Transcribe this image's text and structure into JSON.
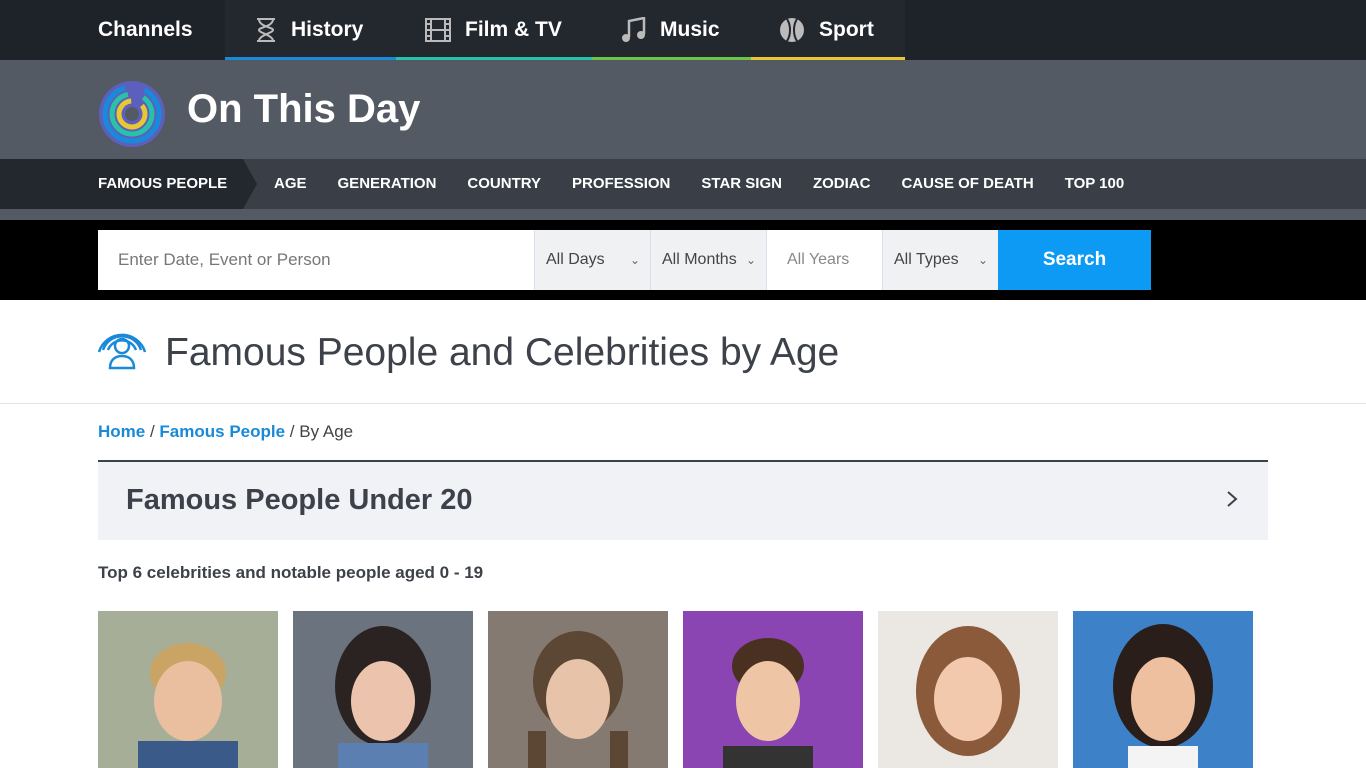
{
  "channels": {
    "title": "Channels",
    "tabs": [
      {
        "label": "History",
        "icon": "hourglass-icon",
        "color": "#1a8ad8"
      },
      {
        "label": "Film & TV",
        "icon": "film-strip-icon",
        "color": "#27c2a8"
      },
      {
        "label": "Music",
        "icon": "music-note-icon",
        "color": "#6cc34a"
      },
      {
        "label": "Sport",
        "icon": "baseball-icon",
        "color": "#e8c832"
      }
    ]
  },
  "brand": {
    "name": "On This Day"
  },
  "nav": {
    "items": [
      "FAMOUS PEOPLE",
      "AGE",
      "GENERATION",
      "COUNTRY",
      "PROFESSION",
      "STAR SIGN",
      "ZODIAC",
      "CAUSE OF DEATH",
      "TOP 100"
    ],
    "active": "FAMOUS PEOPLE"
  },
  "search": {
    "placeholder": "Enter Date, Event or Person",
    "days": "All Days",
    "months": "All Months",
    "years": "All Years",
    "types": "All Types",
    "button": "Search"
  },
  "page": {
    "title": "Famous People and Celebrities by Age"
  },
  "breadcrumb": {
    "home": "Home",
    "section": "Famous People",
    "current": "By Age"
  },
  "section": {
    "heading": "Famous People Under 20",
    "subtitle": "Top 6 celebrities and notable people aged 0 - 19"
  },
  "photos": [
    {
      "bg": "#9aa48a"
    },
    {
      "bg": "#5a6370"
    },
    {
      "bg": "#7a706a"
    },
    {
      "bg": "#7d3fa3"
    },
    {
      "bg": "#e4e0dc"
    },
    {
      "bg": "#3b7dc4"
    }
  ]
}
